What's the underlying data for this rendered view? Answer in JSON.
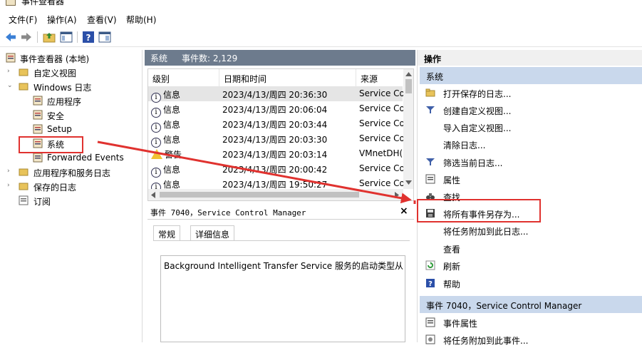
{
  "window": {
    "title": "事件查看器"
  },
  "menu": [
    "文件(F)",
    "操作(A)",
    "查看(V)",
    "帮助(H)"
  ],
  "tree": {
    "root": "事件查看器 (本地)",
    "custom_views": "自定义视图",
    "windows_logs": "Windows 日志",
    "application": "应用程序",
    "security": "安全",
    "setup": "Setup",
    "system": "系统",
    "forwarded": "Forwarded Events",
    "app_service_logs": "应用程序和服务日志",
    "saved_logs": "保存的日志",
    "subscriptions": "订阅"
  },
  "center": {
    "log_name": "系统",
    "event_count": "事件数: 2,129",
    "columns": [
      "级别",
      "日期和时间",
      "来源"
    ],
    "rows": [
      {
        "level": "信息",
        "date": "2023/4/13/周四 20:36:30",
        "source": "Service Co",
        "icon": "info-icon"
      },
      {
        "level": "信息",
        "date": "2023/4/13/周四 20:06:04",
        "source": "Service Co",
        "icon": "info-icon"
      },
      {
        "level": "信息",
        "date": "2023/4/13/周四 20:03:44",
        "source": "Service Co",
        "icon": "info-icon"
      },
      {
        "level": "信息",
        "date": "2023/4/13/周四 20:03:30",
        "source": "Service Co",
        "icon": "info-icon"
      },
      {
        "level": "警告",
        "date": "2023/4/13/周四 20:03:14",
        "source": "VMnetDH(",
        "icon": "warning-icon"
      },
      {
        "level": "信息",
        "date": "2023/4/13/周四 20:00:42",
        "source": "Service Co",
        "icon": "info-icon"
      },
      {
        "level": "信息",
        "date": "2023/4/13/周四 19:50:27",
        "source": "Service Co",
        "icon": "info-icon"
      }
    ],
    "detail_title": "事件 7040，Service Control Manager",
    "tabs": [
      "常规",
      "详细信息"
    ],
    "description": "Background Intelligent Transfer Service 服务的启动类型从 按"
  },
  "actions": {
    "header": "操作",
    "section1": "系统",
    "items1": [
      {
        "label": "打开保存的日志...",
        "icon": "folder-icon"
      },
      {
        "label": "创建自定义视图...",
        "icon": "filter-icon"
      },
      {
        "label": "导入自定义视图...",
        "icon": ""
      },
      {
        "label": "清除日志...",
        "icon": ""
      },
      {
        "label": "筛选当前日志...",
        "icon": "filter-icon"
      },
      {
        "label": "属性",
        "icon": "properties-icon"
      },
      {
        "label": "查找...",
        "icon": "binoculars-icon"
      },
      {
        "label": "将所有事件另存为...",
        "icon": "save-icon"
      },
      {
        "label": "将任务附加到此日志...",
        "icon": ""
      },
      {
        "label": "查看",
        "icon": ""
      },
      {
        "label": "刷新",
        "icon": "refresh-icon"
      },
      {
        "label": "帮助",
        "icon": "help-icon"
      }
    ],
    "section2": "事件 7040，Service Control Manager",
    "items2": [
      {
        "label": "事件属性",
        "icon": "properties-icon"
      },
      {
        "label": "将任务附加到此事件...",
        "icon": "task-icon"
      }
    ]
  },
  "colors": {
    "accent_red": "#e0322f",
    "header_slate": "#6d7b8d",
    "section_blue": "#c9d8ec"
  }
}
